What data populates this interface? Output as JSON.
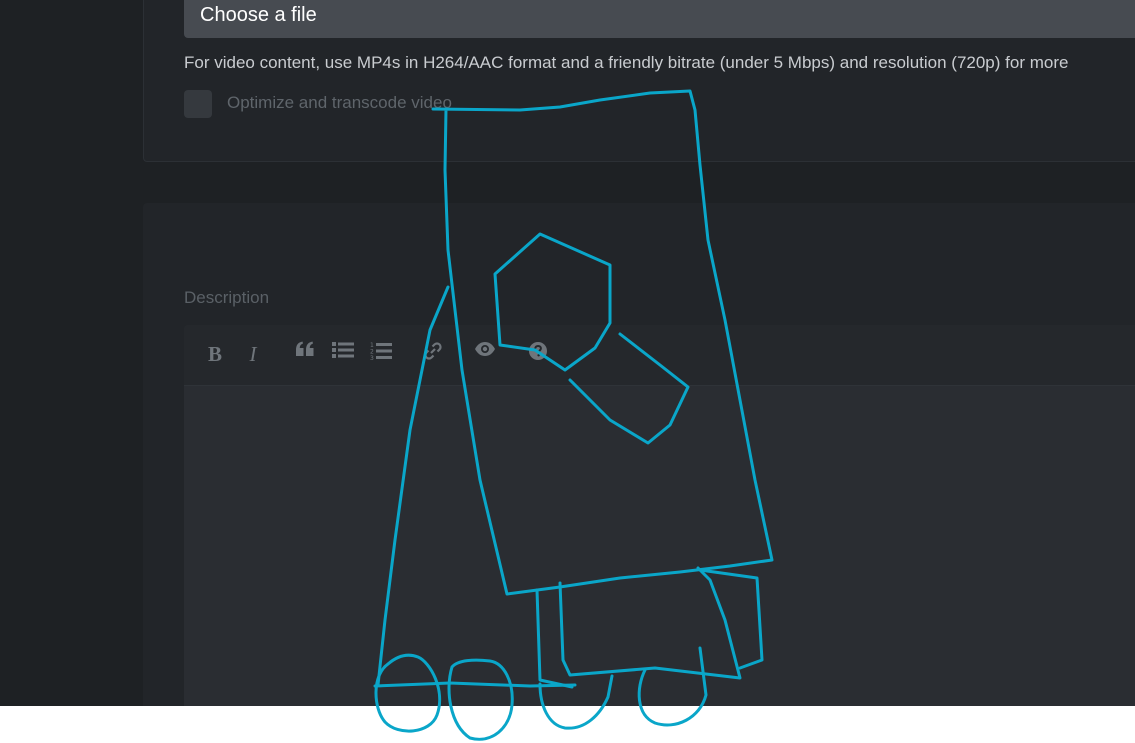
{
  "upload": {
    "file_button_label": "Choose a file",
    "hint": "For video content, use MP4s in H264/AAC format and a friendly bitrate (under 5 Mbps) and resolution (720p) for more",
    "optimize_label": "Optimize and transcode video"
  },
  "description": {
    "label": "Description",
    "toolbar": [
      {
        "name": "bold",
        "label": "B",
        "icon": "bold-icon"
      },
      {
        "name": "italic",
        "label": "I",
        "icon": "italic-icon"
      },
      {
        "name": "quote",
        "icon": "quote-icon"
      },
      {
        "name": "unordered-list",
        "icon": "bulleted-list-icon"
      },
      {
        "name": "ordered-list",
        "icon": "numbered-list-icon"
      },
      {
        "name": "link",
        "icon": "link-icon"
      },
      {
        "name": "preview",
        "icon": "eye-icon"
      },
      {
        "name": "help",
        "icon": "question-circle-icon"
      }
    ]
  },
  "colors": {
    "background": "#1e2124",
    "card": "#222529",
    "file_button": "#474b51",
    "annotation_stroke": "#0aa6c9"
  }
}
